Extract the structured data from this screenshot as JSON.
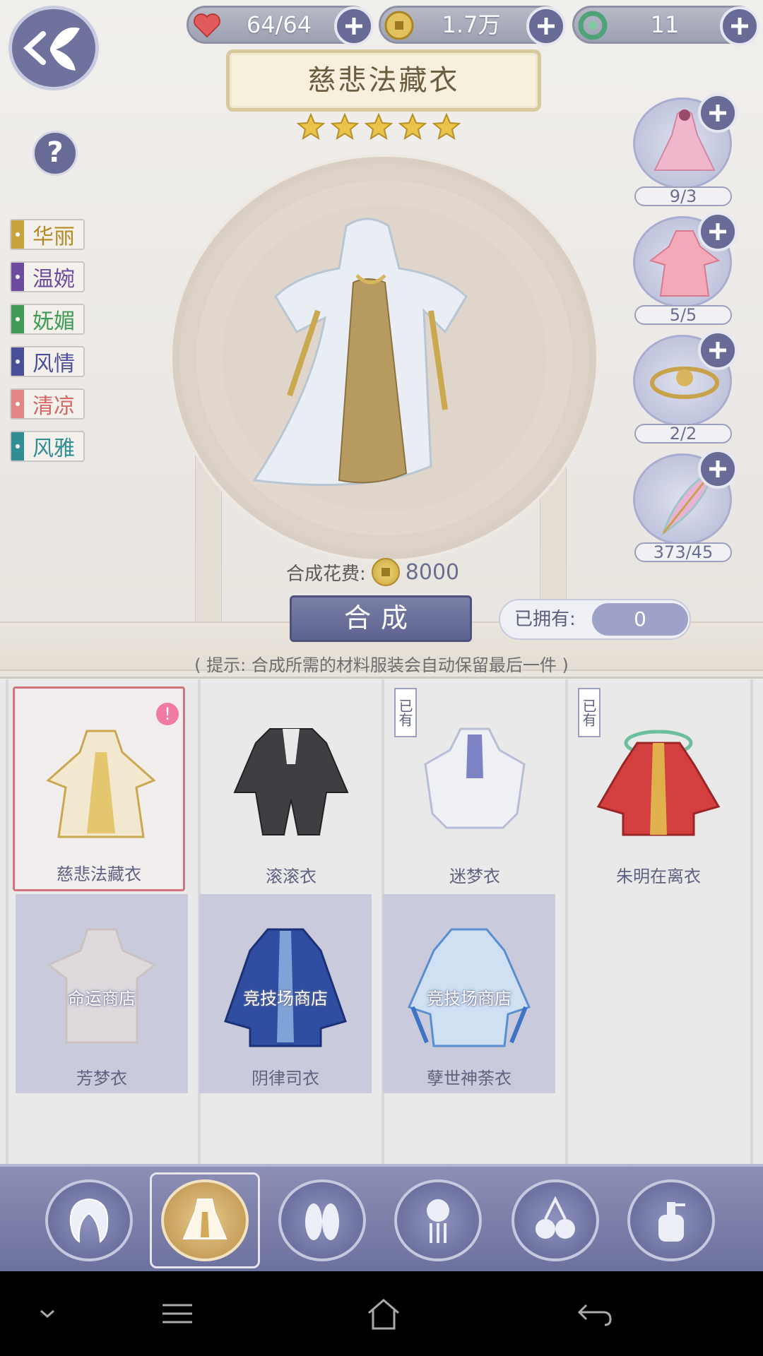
{
  "header": {
    "resources": [
      {
        "name": "heart-icon",
        "value": "64/64"
      },
      {
        "name": "coin-icon",
        "value": "1.7万"
      },
      {
        "name": "jade-icon",
        "value": "11"
      }
    ],
    "title": "慈悲法藏衣",
    "stars": 5,
    "help": "?"
  },
  "style_tags": [
    {
      "label": "华丽",
      "color": "#c9a33b"
    },
    {
      "label": "温婉",
      "color": "#6b4aa0"
    },
    {
      "label": "妩媚",
      "color": "#3f9b56"
    },
    {
      "label": "风情",
      "color": "#4b4f9a"
    },
    {
      "label": "清凉",
      "color": "#e38585"
    },
    {
      "label": "风雅",
      "color": "#2f8d93"
    }
  ],
  "materials": [
    {
      "count": "9/3",
      "icon": "pink-dress-icon"
    },
    {
      "count": "5/5",
      "icon": "pink-robe-icon"
    },
    {
      "count": "2/2",
      "icon": "gold-ornament-icon"
    },
    {
      "count": "373/45",
      "icon": "feather-icon"
    }
  ],
  "craft": {
    "cost_label": "合成花费:",
    "cost_value": "8000",
    "button": "合成",
    "owned_label": "已拥有:",
    "owned_value": "0",
    "hint": "( 提示: 合成所需的材料服装会自动保留最后一件 )"
  },
  "items": [
    {
      "name": "慈悲法藏衣",
      "state": "selected",
      "badge": "!",
      "owned": false
    },
    {
      "name": "滚滚衣",
      "state": "normal",
      "owned": false
    },
    {
      "name": "迷梦衣",
      "state": "normal",
      "owned": true
    },
    {
      "name": "朱明在离衣",
      "state": "normal",
      "owned": true
    },
    {
      "name": "芳梦衣",
      "state": "locked",
      "source": "命运商店"
    },
    {
      "name": "阴律司衣",
      "state": "locked",
      "source": "竞技场商店"
    },
    {
      "name": "孽世神荼衣",
      "state": "locked",
      "source": "竞技场商店"
    }
  ],
  "owned_tag": "已有",
  "bottom_nav": [
    {
      "icon": "hair-icon",
      "active": false
    },
    {
      "icon": "dress-icon",
      "active": true
    },
    {
      "icon": "shoes-icon",
      "active": false
    },
    {
      "icon": "hairpin-icon",
      "active": false
    },
    {
      "icon": "bell-accessory-icon",
      "active": false
    },
    {
      "icon": "makeup-bottle-icon",
      "active": false
    }
  ],
  "system_nav": [
    "chevron-down-icon",
    "menu-icon",
    "home-icon",
    "back-icon"
  ]
}
